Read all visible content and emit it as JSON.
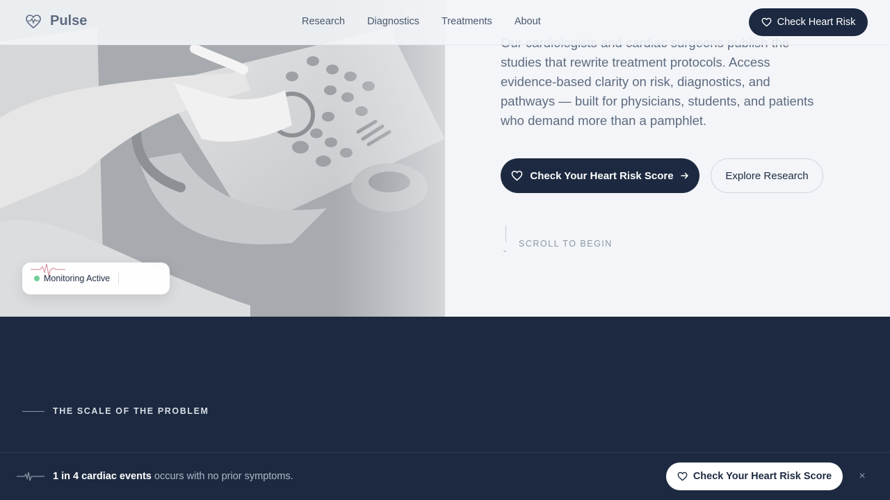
{
  "nav": {
    "brand": "Pulse",
    "links": [
      "Research",
      "Diagnostics",
      "Treatments",
      "About"
    ],
    "cta_label": "Check Heart Risk"
  },
  "hero": {
    "paragraph": "Our cardiologists and cardiac surgeons publish the studies that rewrite treatment protocols. Access evidence-based clarity on risk, diagnostics, and pathways — built for physicians, students, and patients who demand more than a pamphlet.",
    "primary_cta": "Check Your Heart Risk Score",
    "secondary_cta": "Explore Research",
    "scroll_hint": "SCROLL TO BEGIN",
    "monitor_status": "Monitoring Active"
  },
  "stats": {
    "section_label": "THE SCALE OF THE PROBLEM"
  },
  "sticky_bar": {
    "highlight": "1 in 4 cardiac events",
    "message": " occurs with no prior symptoms.",
    "cta_label": "Check Your Heart Risk Score",
    "close_glyph": "×"
  },
  "icons": {
    "brand": "heart-pulse-icon",
    "cta": "heart-outline-icon",
    "arrow": "arrow-right-icon",
    "scroll": "chevron-down-icon",
    "wave": "ecg-wave-icon",
    "close": "close-icon"
  },
  "colors": {
    "navy": "#1c2940",
    "background": "#f3f5f8",
    "status_green": "#6fcf97",
    "ecg_pink": "#d99aa3"
  }
}
